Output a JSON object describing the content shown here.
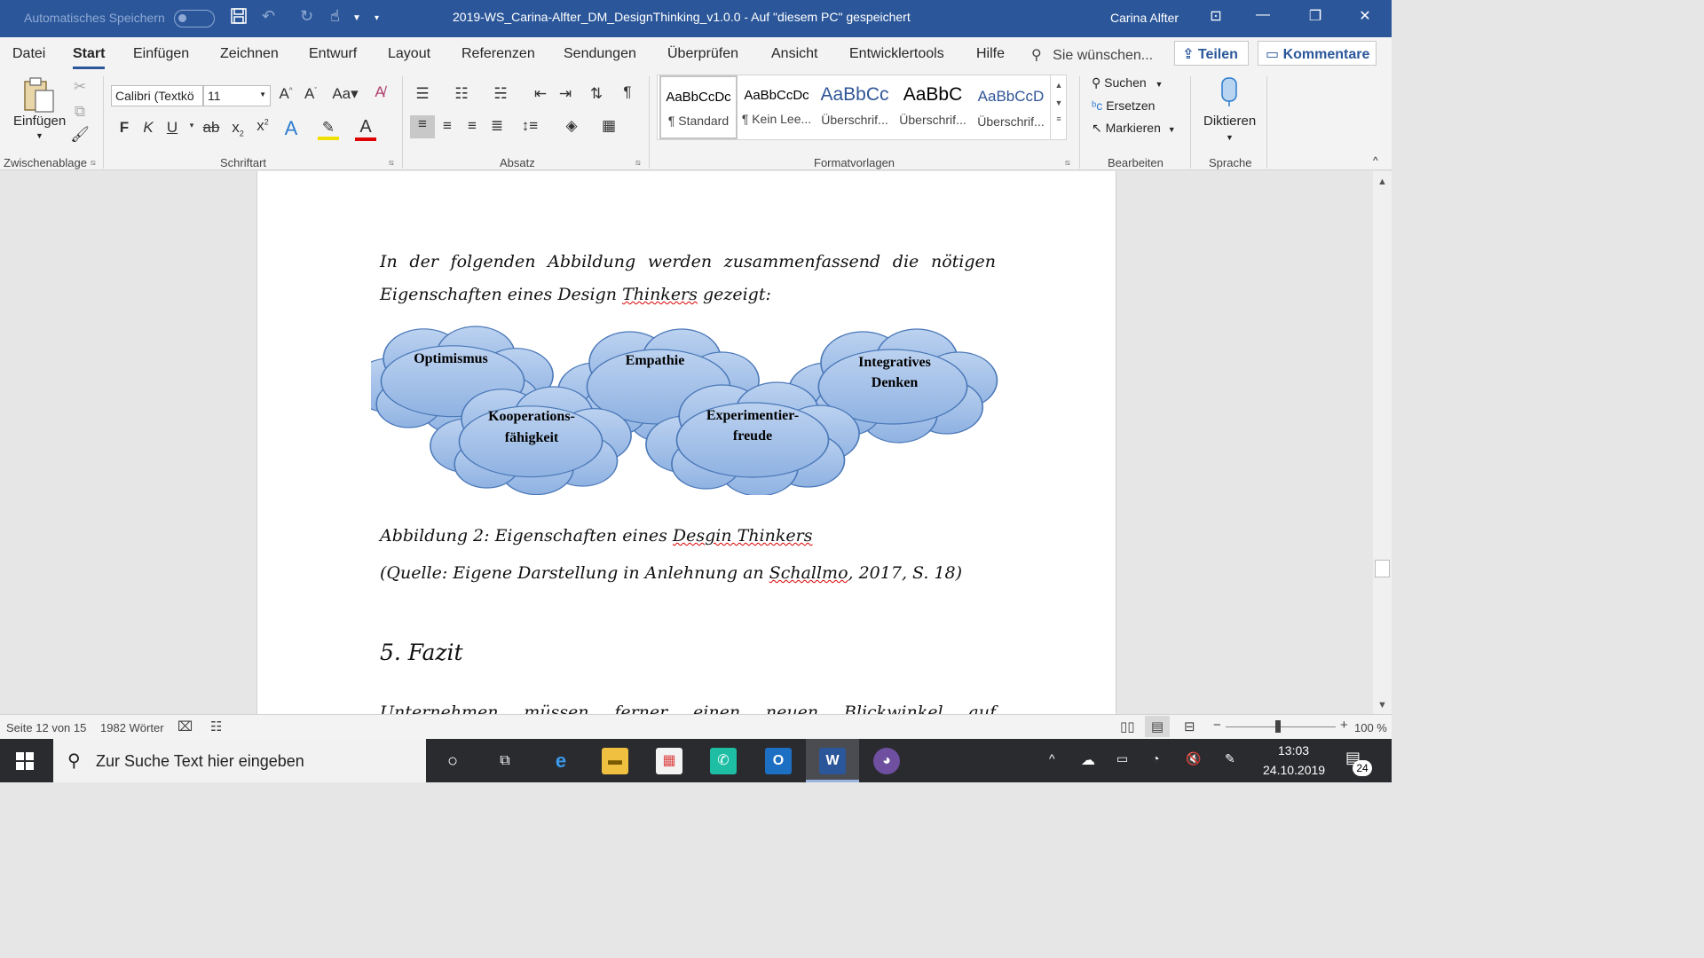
{
  "titlebar": {
    "autosave_label": "Automatisches Speichern",
    "document_title": "2019-WS_Carina-Alfter_DM_DesignThinking_v1.0.0  -  Auf \"diesem PC\" gespeichert",
    "user_name": "Carina Alfter"
  },
  "tabs": [
    "Datei",
    "Start",
    "Einfügen",
    "Zeichnen",
    "Entwurf",
    "Layout",
    "Referenzen",
    "Sendungen",
    "Überprüfen",
    "Ansicht",
    "Entwicklertools",
    "Hilfe"
  ],
  "tellme": "Sie wünschen...",
  "share_label": "Teilen",
  "comments_label": "Kommentare",
  "ribbon": {
    "paste_label": "Einfügen",
    "clipboard_label": "Zwischenablage",
    "font_name": "Calibri (Textkö",
    "font_size": "11",
    "font_group_label": "Schriftart",
    "paragraph_label": "Absatz",
    "styles_label": "Formatvorlagen",
    "styles": [
      {
        "preview": "AaBbCcDc",
        "name": "¶ Standard"
      },
      {
        "preview": "AaBbCcDc",
        "name": "¶ Kein Lee..."
      },
      {
        "preview": "AaBbCc",
        "name": "Überschrif..."
      },
      {
        "preview": "AaBbC",
        "name": "Überschrif..."
      },
      {
        "preview": "AaBbCcD",
        "name": "Überschrif..."
      }
    ],
    "find_label": "Suchen",
    "replace_label": "Ersetzen",
    "select_label": "Markieren",
    "editing_label": "Bearbeiten",
    "dictate_label": "Diktieren",
    "voice_label": "Sprache",
    "case_label": "Aa"
  },
  "document": {
    "intro_line1": "In der folgenden Abbildung werden zusammenfassend die nötigen",
    "intro_line2_pre": "Eigenschaften eines Design ",
    "intro_line2_err": "Thinkers",
    "intro_line2_post": " gezeigt:",
    "clouds": {
      "optimismus": "Optimismus",
      "empathie": "Empathie",
      "integratives1": "Integratives",
      "integratives2": "Denken",
      "kooperation1": "Kooperations-",
      "kooperation2": "fähigkeit",
      "experiment1": "Experimentier-",
      "experiment2": "freude"
    },
    "caption_pre": "Abbildung 2: Eigenschaften eines ",
    "caption_err": "Desgin Thinkers",
    "source_pre": "(Quelle: Eigene Darstellung in Anlehnung an ",
    "source_err": "Schallmo",
    "source_post": ", 2017, S. 18)",
    "heading": "5. Fazit",
    "next_para": "Unternehmen müssen ferner einen neuen Blickwinkel auf"
  },
  "statusbar": {
    "page": "Seite 12 von 15",
    "words": "1982 Wörter",
    "zoom": "100 %"
  },
  "taskbar": {
    "search_placeholder": "Zur Suche Text hier eingeben",
    "time": "13:03",
    "date": "24.10.2019",
    "notifications": "24"
  },
  "colors": {
    "word_blue": "#2b579a",
    "cloud_fill": "#9fbde6",
    "cloud_stroke": "#4a78b8"
  }
}
